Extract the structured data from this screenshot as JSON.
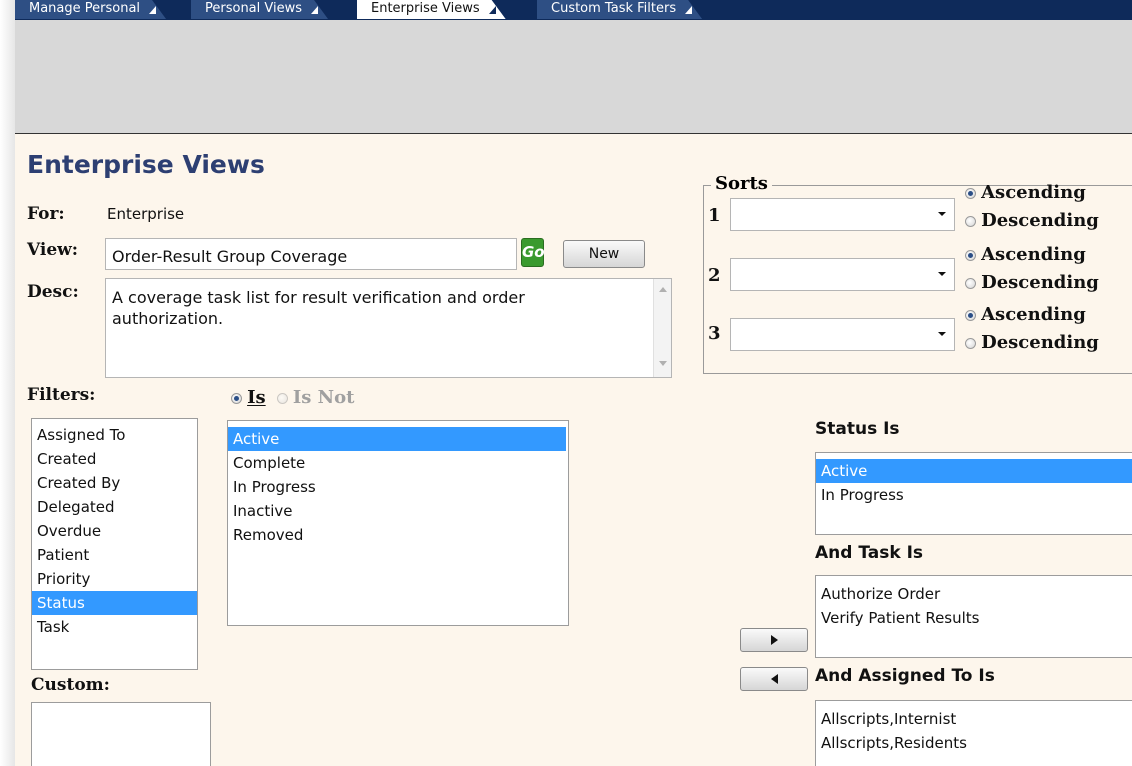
{
  "tabs": [
    {
      "label": "Manage Personal",
      "active": false
    },
    {
      "label": "Personal Views",
      "active": false
    },
    {
      "label": "Enterprise Views",
      "active": true
    },
    {
      "label": "Custom Task Filters",
      "active": false
    }
  ],
  "page": {
    "title": "Enterprise Views",
    "for_label": "For:",
    "for_value": "Enterprise",
    "view_label": "View:",
    "view_value": "Order-Result Group Coverage",
    "go_label": "Go",
    "new_label": "New",
    "desc_label": "Desc:",
    "desc_value": "A coverage task list for result verification and order authorization."
  },
  "sorts": {
    "legend": "Sorts",
    "rows": [
      {
        "num": "1",
        "value": "",
        "asc": "Ascending",
        "desc": "Descending",
        "selected": "asc"
      },
      {
        "num": "2",
        "value": "",
        "asc": "Ascending",
        "desc": "Descending",
        "selected": "asc"
      },
      {
        "num": "3",
        "value": "",
        "asc": "Ascending",
        "desc": "Descending",
        "selected": "asc"
      }
    ]
  },
  "filters": {
    "label": "Filters:",
    "is_label": "Is",
    "is_not_label": "Is Not",
    "items": [
      "Assigned To",
      "Created",
      "Created By",
      "Delegated",
      "Overdue",
      "Patient",
      "Priority",
      "Status",
      "Task"
    ],
    "selected": "Status",
    "values": [
      "Active",
      "Complete",
      "In Progress",
      "Inactive",
      "Removed"
    ],
    "selected_value": "Active"
  },
  "custom": {
    "label": "Custom:"
  },
  "criteria": {
    "status_head": "Status Is",
    "status_items": [
      "Active",
      "In Progress"
    ],
    "status_selected": "Active",
    "task_head": "And Task Is",
    "task_items": [
      "Authorize Order",
      "Verify Patient Results"
    ],
    "assigned_head": "And Assigned To Is",
    "assigned_items": [
      "Allscripts,Internist",
      "Allscripts,Residents"
    ]
  },
  "icons": {
    "add": "arrow-right-icon",
    "remove": "arrow-left-icon"
  }
}
